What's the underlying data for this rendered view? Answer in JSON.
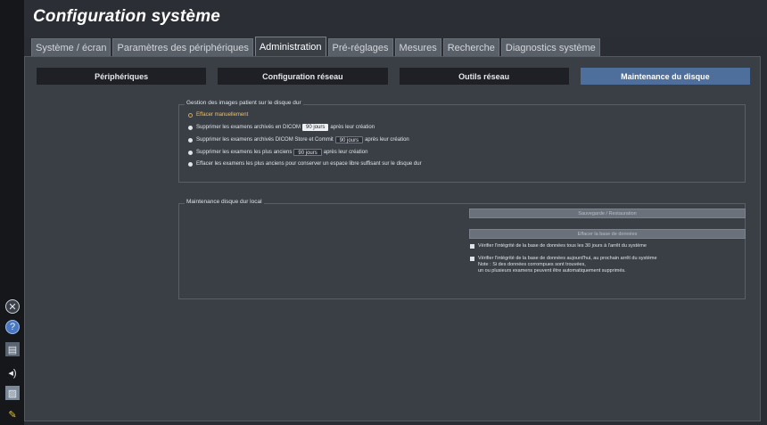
{
  "title": "Configuration système",
  "tabs": [
    "Système / écran",
    "Paramètres des périphériques",
    "Administration",
    "Pré-réglages",
    "Mesures",
    "Recherche",
    "Diagnostics système"
  ],
  "active_tab": "Administration",
  "subtabs": [
    "Périphériques",
    "Configuration réseau",
    "Outils réseau",
    "Maintenance du disque"
  ],
  "active_subtab": "Maintenance du disque",
  "group1": {
    "legend": "Gestion des images patient sur le disque dur",
    "opt1": "Effacer manuellement",
    "opt2_pre": "Supprimer les examens archivés en DICOM",
    "opt2_val": "90 jours",
    "opt2_post": "après leur création",
    "opt3_pre": "Supprimer les examens archivés DICOM Store et Commit",
    "opt3_val": "90 jours",
    "opt3_post": "après leur création",
    "opt4_pre": "Supprimer les examens les plus anciens",
    "opt4_val": "90 jours",
    "opt4_post": "après leur création",
    "opt5": "Effacer les examens les plus anciens pour conserver un espace libre suffisant sur le disque dur"
  },
  "group2": {
    "legend": "Maintenance disque dur local",
    "backup_button": "Sauvegarde / Restauration",
    "clear_db_button": "Effacer la base de données",
    "check1": "Vérifier l'intégrité de la base de données tous les 30 jours à l'arrêt du système",
    "check2": "Vérifier l'intégrité de la base de données aujourd'hui, au prochain arrêt du système",
    "note1": "Note : Si des données corrompues sont trouvées,",
    "note2": "un ou plusieurs examens peuvent être automatiquement supprimés."
  },
  "icons": [
    "close-circle-icon",
    "help-icon",
    "printer-icon",
    "volume-icon",
    "image-icon",
    "brush-icon"
  ]
}
